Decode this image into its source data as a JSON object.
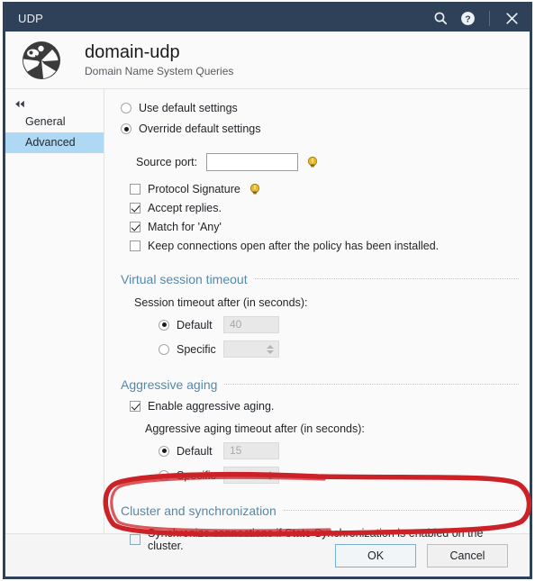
{
  "titlebar": {
    "title": "UDP",
    "icons": [
      {
        "name": "search-icon",
        "label": "Search"
      },
      {
        "name": "help-icon",
        "label": "Help"
      },
      {
        "name": "close-icon",
        "label": "Close"
      }
    ]
  },
  "header": {
    "icon": "dns-globe-icon",
    "title": "domain-udp",
    "subtitle": "Domain Name System Queries"
  },
  "sidebar": {
    "collapse_icon": "double-chevron-left-icon",
    "items": [
      {
        "label": "General",
        "selected": false
      },
      {
        "label": "Advanced",
        "selected": true
      }
    ]
  },
  "main": {
    "defaults": {
      "use_default": {
        "label": "Use default settings",
        "checked": false
      },
      "override_default": {
        "label": "Override default settings",
        "checked": true
      }
    },
    "source_port": {
      "label": "Source port:",
      "value": "",
      "placeholder": "",
      "hint_icon": "lightbulb-icon"
    },
    "checkboxes": [
      {
        "label": "Protocol Signature",
        "checked": false,
        "hint_icon": "lightbulb-icon"
      },
      {
        "label": "Accept replies.",
        "checked": true,
        "hint_icon": ""
      },
      {
        "label": "Match for 'Any'",
        "checked": true,
        "hint_icon": ""
      },
      {
        "label": "Keep connections open after the policy has been installed.",
        "checked": false,
        "hint_icon": ""
      }
    ],
    "virtual_session_timeout": {
      "section_title": "Virtual session timeout",
      "sub_label": "Session timeout after (in seconds):",
      "default": {
        "label": "Default",
        "selected": true,
        "value": "40"
      },
      "specific": {
        "label": "Specific",
        "selected": false,
        "value": ""
      }
    },
    "aggressive_aging": {
      "section_title": "Aggressive aging",
      "enable": {
        "label": "Enable aggressive aging.",
        "checked": true
      },
      "sub_label": "Aggressive aging timeout after (in seconds):",
      "default": {
        "label": "Default",
        "selected": true,
        "value": "15"
      },
      "specific": {
        "label": "Specific",
        "selected": false,
        "value": ""
      }
    },
    "cluster": {
      "section_title": "Cluster and synchronization",
      "sync": {
        "label": "Synchronize connections if State Synchronization is enabled on the cluster.",
        "checked": false
      }
    }
  },
  "footer": {
    "ok_label": "OK",
    "cancel_label": "Cancel"
  },
  "annotation": {
    "name": "red-ellipse-highlight",
    "color": "#cc2127"
  },
  "colors": {
    "titlebar_bg": "#2e4158",
    "section_header": "#5588ab",
    "selected_sidebar": "#aed8f4",
    "hint_bulb": "#e8b72a"
  }
}
